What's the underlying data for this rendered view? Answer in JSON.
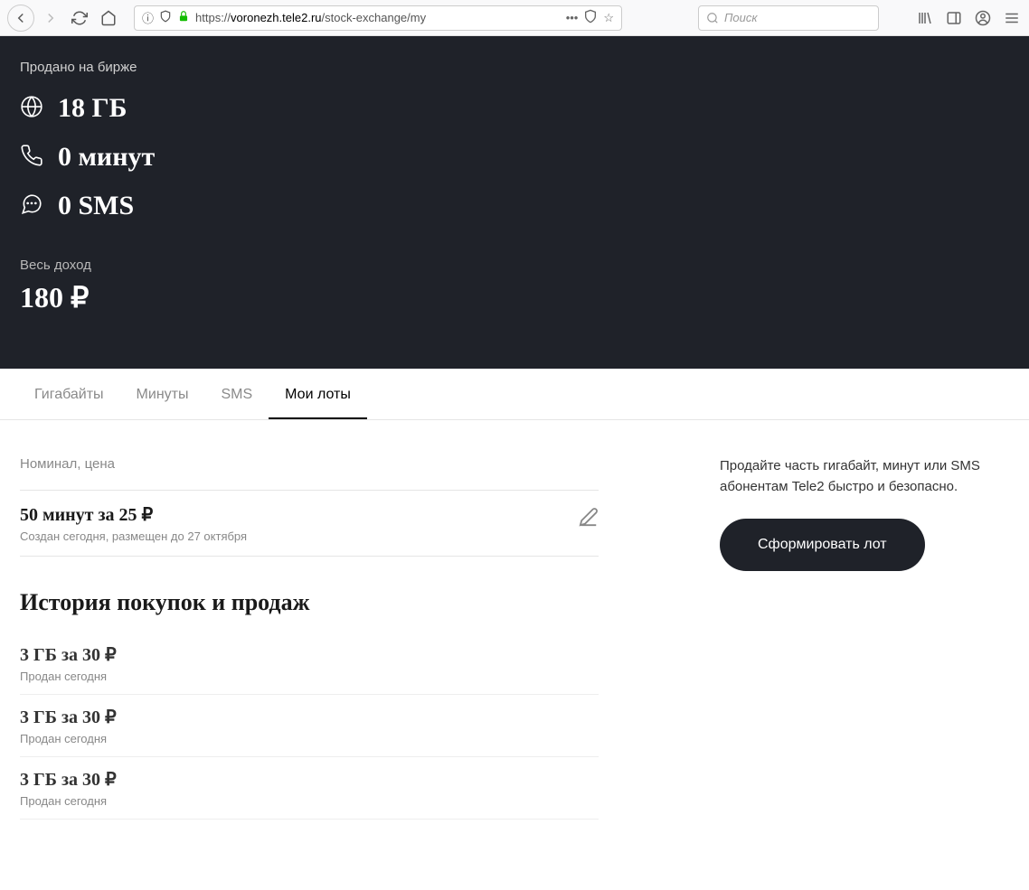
{
  "browser": {
    "url_prefix": "https://",
    "url_domain": "voronezh.tele2.ru",
    "url_path": "/stock-exchange/my",
    "search_placeholder": "Поиск"
  },
  "hero": {
    "sold_label": "Продано на бирже",
    "data_value": "18 ГБ",
    "minutes_value": "0 минут",
    "sms_value": "0 SMS",
    "income_label": "Весь доход",
    "income_value": "180 ₽"
  },
  "tabs": [
    {
      "label": "Гигабайты",
      "active": false
    },
    {
      "label": "Минуты",
      "active": false
    },
    {
      "label": "SMS",
      "active": false
    },
    {
      "label": "Мои лоты",
      "active": true
    }
  ],
  "lots": {
    "section_label": "Номинал, цена",
    "current": {
      "title": "50 минут за 25 ₽",
      "subtitle": "Создан сегодня, размещен до 27 октября"
    },
    "history_heading": "История покупок и продаж",
    "history": [
      {
        "title": "3 ГБ за 30 ₽",
        "subtitle": "Продан сегодня"
      },
      {
        "title": "3 ГБ за 30 ₽",
        "subtitle": "Продан сегодня"
      },
      {
        "title": "3 ГБ за 30 ₽",
        "subtitle": "Продан сегодня"
      }
    ]
  },
  "sidebar": {
    "promo_text": "Продайте часть гигабайт, минут или SMS абонентам Tele2 быстро и безопасно.",
    "button_label": "Сформировать лот"
  }
}
